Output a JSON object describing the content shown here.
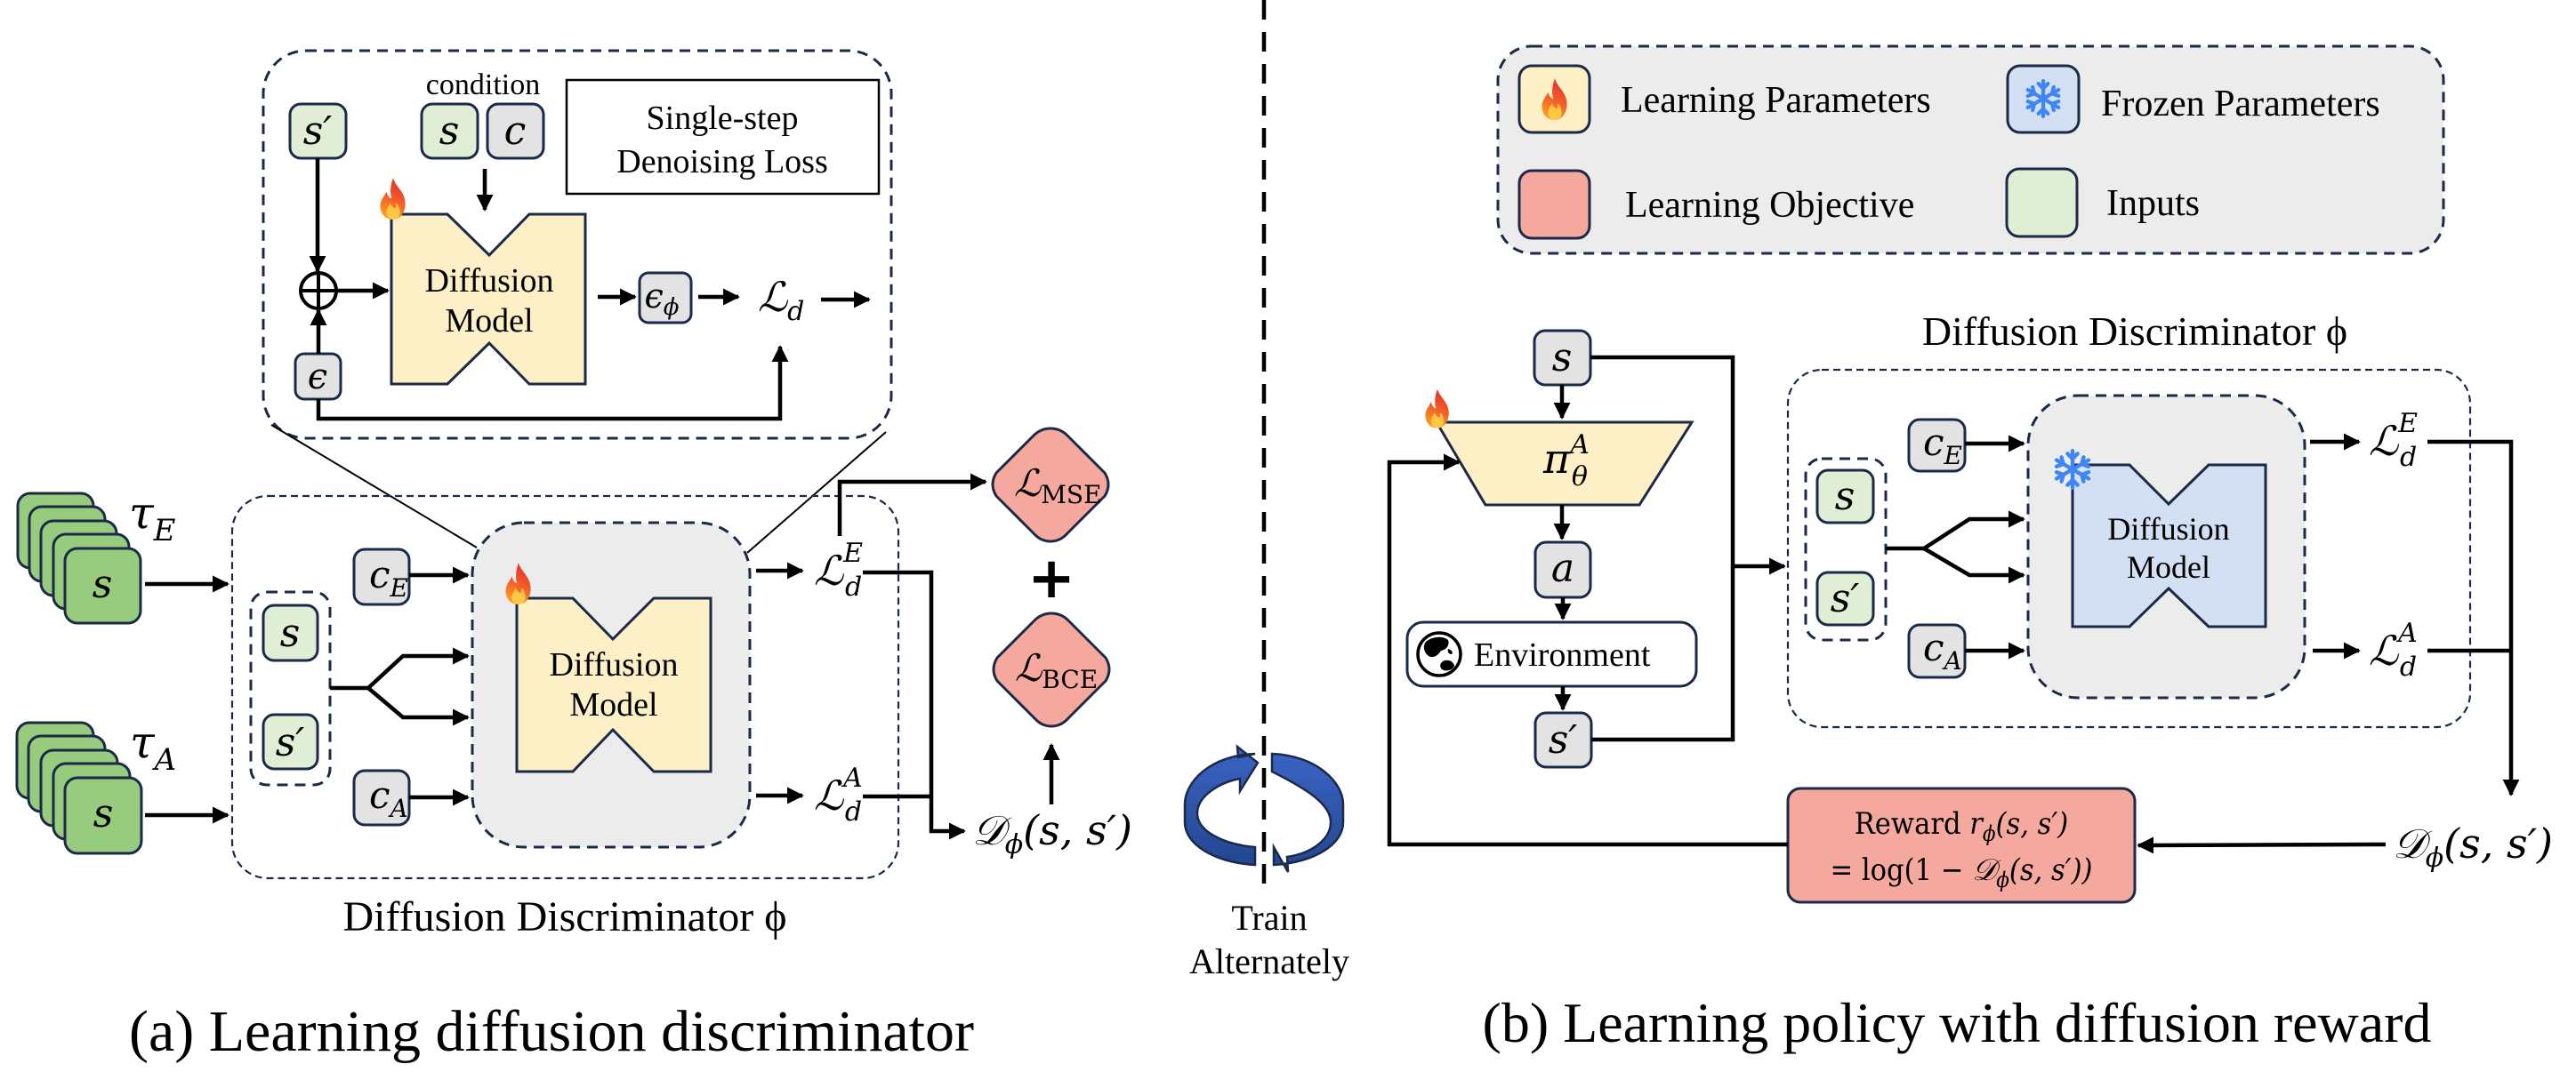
{
  "figure": {
    "divider_style": "dashed",
    "colors": {
      "learning_parameters": "#fef0c6",
      "frozen_parameters": "#d3dff2",
      "learning_objective": "#f5a99e",
      "inputs": "#e0eed6",
      "trajectory_state": "#97cb7d",
      "variable_box": "#e3e3e3",
      "module_bg": "#ececec",
      "outline": "#1b2a48",
      "rotate_arrow": "#2f56a6"
    }
  },
  "panel_a": {
    "caption": "(a) Learning diffusion discriminator",
    "inset": {
      "s_prime": "s′",
      "condition_label": "condition",
      "cond_s": "s",
      "cond_c": "c",
      "noise": "ϵ",
      "plus_symbol": "⊕",
      "model_line1": "Diffusion",
      "model_line2": "Model",
      "eps_phi": "ϵ",
      "eps_phi_sub": "ϕ",
      "loss": "ℒ",
      "loss_sub": "d",
      "title_line1": "Single-step",
      "title_line2": "Denoising Loss"
    },
    "expert_traj": {
      "label": "τ",
      "sub": "E",
      "state": "s"
    },
    "agent_traj": {
      "label": "τ",
      "sub": "A",
      "state": "s"
    },
    "discriminator": {
      "title": "Diffusion Discriminator ϕ",
      "inputs": [
        "s",
        "s′"
      ],
      "cond_expert": {
        "main": "c",
        "sub": "E"
      },
      "cond_agent": {
        "main": "c",
        "sub": "A"
      },
      "model_line1": "Diffusion",
      "model_line2": "Model",
      "param_state": "learning",
      "loss_expert": {
        "main": "ℒ",
        "sup": "E",
        "sub": "d"
      },
      "loss_agent": {
        "main": "ℒ",
        "sup": "A",
        "sub": "d"
      }
    },
    "objectives": {
      "mse": {
        "main": "ℒ",
        "sub": "MSE"
      },
      "plus": "+",
      "bce": {
        "main": "ℒ",
        "sub": "BCE"
      }
    },
    "disc_output": {
      "main": "𝒟",
      "sub": "ϕ",
      "args": "(s, s′)"
    }
  },
  "center": {
    "label_line1": "Train",
    "label_line2": "Alternately"
  },
  "legend": {
    "items": [
      {
        "label": "Learning Parameters",
        "icon": "flame-icon"
      },
      {
        "label": "Frozen Parameters",
        "icon": "snowflake-icon"
      },
      {
        "label": "Learning Objective",
        "icon": ""
      },
      {
        "label": "Inputs",
        "icon": ""
      }
    ]
  },
  "panel_b": {
    "caption": "(b) Learning policy with diffusion reward",
    "state": "s",
    "policy": {
      "main": "π",
      "sup": "A",
      "sub": "θ"
    },
    "action": "a",
    "environment": "Environment",
    "next_state": "s′",
    "discriminator": {
      "title": "Diffusion Discriminator ϕ",
      "inputs": [
        "s",
        "s′"
      ],
      "cond_expert": {
        "main": "c",
        "sub": "E"
      },
      "cond_agent": {
        "main": "c",
        "sub": "A"
      },
      "model_line1": "Diffusion",
      "model_line2": "Model",
      "param_state": "frozen",
      "loss_expert": {
        "main": "ℒ",
        "sup": "E",
        "sub": "d"
      },
      "loss_agent": {
        "main": "ℒ",
        "sup": "A",
        "sub": "d"
      }
    },
    "disc_output": {
      "main": "𝒟",
      "sub": "ϕ",
      "args": "(s, s′)"
    },
    "reward": {
      "line1_prefix": "Reward ",
      "line1_math": "r",
      "line1_sub": "ϕ",
      "line1_args": "(s, s′)",
      "line2_prefix": "= log(1 − ",
      "line2_math": "𝒟",
      "line2_sub": "ϕ",
      "line2_args": "(s, s′))"
    }
  }
}
